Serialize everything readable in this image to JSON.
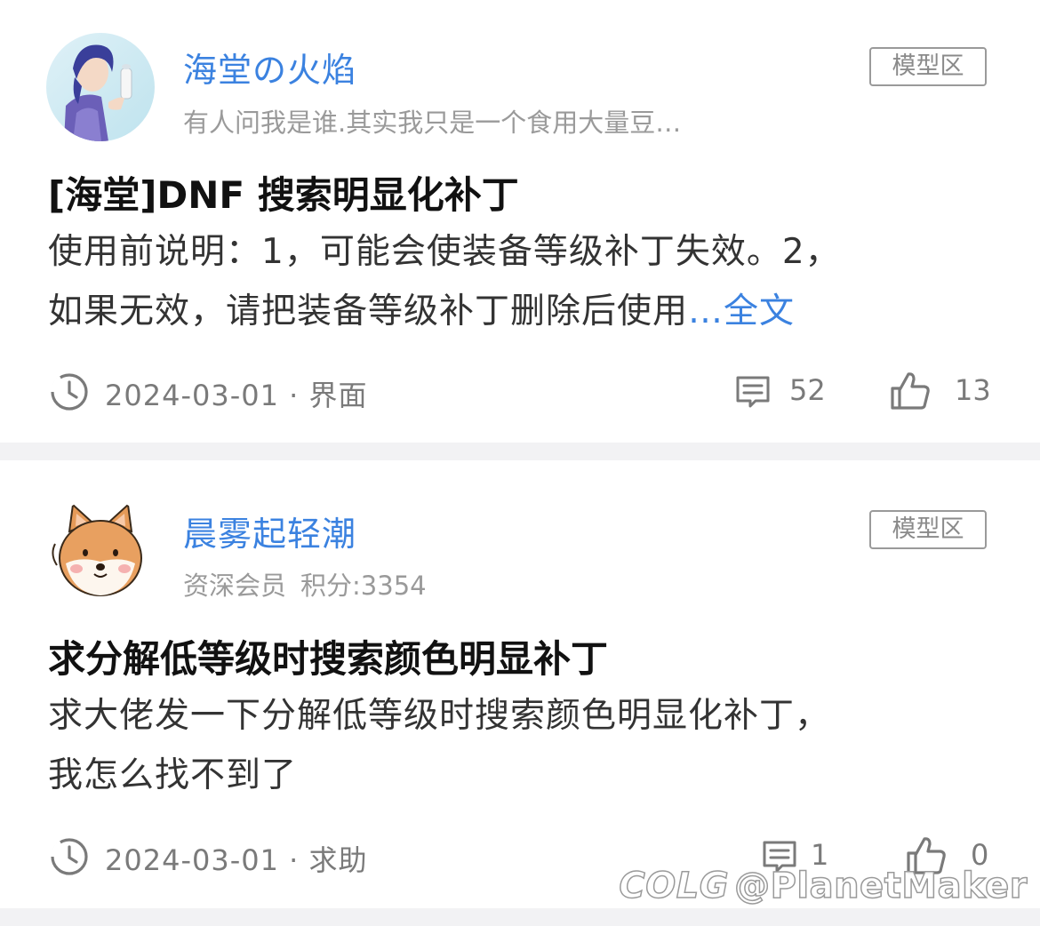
{
  "posts": [
    {
      "author": "海堂の火焰",
      "subtitle": "有人问我是谁.其实我只是一个食用大量豆…",
      "tag": "模型区",
      "title": "[海堂]DNF 搜索明显化补丁",
      "body_line1": "使用前说明：1，可能会使装备等级补丁失效。2，",
      "body_line2": "如果无效，请把装备等级补丁删除后使用",
      "more": "…全文",
      "date_category": "2024-03-01 · 界面",
      "comments": "52",
      "likes": "13"
    },
    {
      "author": "晨雾起轻潮",
      "subtitle_rank": "资深会员",
      "subtitle_points": "积分:3354",
      "tag": "模型区",
      "title": "求分解低等级时搜索颜色明显补丁",
      "body_line1": "求大佬发一下分解低等级时搜索颜色明显化补丁，",
      "body_line2": "我怎么找不到了",
      "date_category": "2024-03-01 · 求助",
      "comments": "1",
      "likes": "0"
    }
  ],
  "watermark": {
    "logo": "COLG",
    "handle": "@PlanetMaker"
  },
  "colors": {
    "accent": "#3b82e0",
    "divider": "#f2f2f4",
    "meta": "#7a7a7a"
  },
  "icons": [
    "clock-icon",
    "comment-icon",
    "thumbs-up-icon"
  ]
}
